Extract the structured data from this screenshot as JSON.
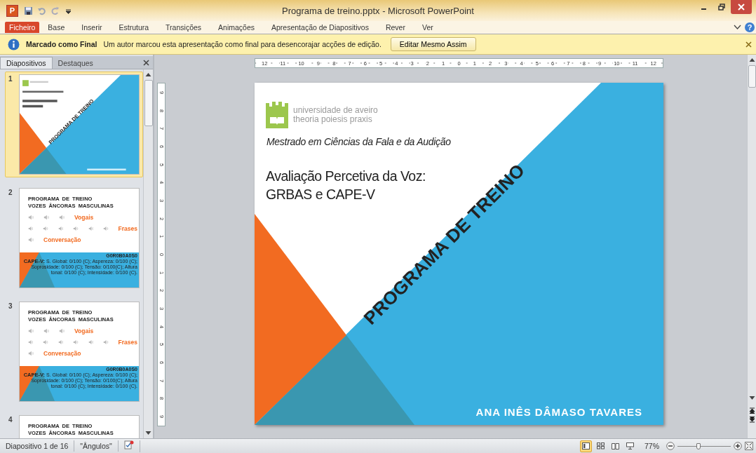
{
  "window": {
    "app_badge": "P",
    "title": "Programa de treino.pptx - Microsoft PowerPoint",
    "help": "?"
  },
  "ribbon_tabs": [
    {
      "label": "Ficheiro",
      "kind": "file"
    },
    {
      "label": "Base",
      "kind": "tab"
    },
    {
      "label": "Inserir",
      "kind": "tab"
    },
    {
      "label": "Estrutura",
      "kind": "tab"
    },
    {
      "label": "Transições",
      "kind": "tab"
    },
    {
      "label": "Animações",
      "kind": "tab"
    },
    {
      "label": "Apresentação de Diapositivos",
      "kind": "tab"
    },
    {
      "label": "Rever",
      "kind": "tab"
    },
    {
      "label": "Ver",
      "kind": "tab"
    }
  ],
  "message_bar": {
    "title": "Marcado como Final",
    "message": "Um autor marcou esta apresentação como final para desencorajar acções de edição.",
    "button": "Editar Mesmo Assim"
  },
  "panel_tabs": [
    {
      "label": "Diapositivos",
      "selected": true
    },
    {
      "label": "Destaques",
      "selected": false
    }
  ],
  "thumbnails": [
    {
      "number": "1",
      "selected": true,
      "kind": "title",
      "heading": "PROGRAMA DE TREINO"
    },
    {
      "number": "2",
      "selected": false,
      "kind": "audio",
      "lines": [
        "PROGRAMA  DE  TREINO",
        "VOZES  ÂNCORAS  MASCULINAS"
      ],
      "labels": [
        "Vogais",
        "Frases",
        "Conversação"
      ],
      "score": "G0R0B0A0S0",
      "cape": "**CAPE-V:** S. Global: 0/100 (C); Aspereza: 0/100 (C); Soprosidade: 0/100 (C); Tensão: 0/100(C); Altura tonal: 0/100 (C); Intensidade: 0/100 (C)."
    },
    {
      "number": "3",
      "selected": false,
      "kind": "audio",
      "lines": [
        "PROGRAMA  DE  TREINO",
        "VOZES  ÂNCORAS  MASCULINAS"
      ],
      "labels": [
        "Vogais",
        "Frases",
        "Conversação"
      ],
      "score": "G0R0B0A0S0",
      "cape": "**CAPE-V:** S. Global: 0/100 (C); Aspereza: 0/100 (C); Soprosidade: 0/100 (C); Tensão: 0/100(C); Altura tonal: 0/100 (C); Intensidade: 0/100 (C)."
    },
    {
      "number": "4",
      "selected": false,
      "kind": "audio",
      "lines": [
        "PROGRAMA  DE  TREINO",
        "VOZES  ÂNCORAS  MASCULINAS"
      ]
    }
  ],
  "ruler": {
    "horizontal": [
      "12",
      "11",
      "10",
      "9",
      "8",
      "7",
      "6",
      "5",
      "4",
      "3",
      "2",
      "1",
      "0",
      "1",
      "2",
      "3",
      "4",
      "5",
      "6",
      "7",
      "8",
      "9",
      "10",
      "11",
      "12"
    ],
    "vertical": [
      "9",
      "8",
      "7",
      "6",
      "5",
      "4",
      "3",
      "2",
      "1",
      "0",
      "1",
      "2",
      "3",
      "4",
      "5",
      "6",
      "7",
      "8",
      "9"
    ]
  },
  "slide": {
    "logo_name": "universidade de aveiro",
    "logo_motto": "theoria poiesis praxis",
    "program": "Mestrado em Ciências da Fala e da Audição",
    "title_lines": [
      "Avaliação Percetiva da Voz:",
      "GRBAS e CAPE-V"
    ],
    "banner": "PROGRAMA DE TREINO",
    "author": "ANA INÊS DÂMASO TAVARES"
  },
  "status_bar": {
    "slide_info": "Diapositivo 1 de 16",
    "theme": "\"Ângulos\"",
    "views": [
      {
        "kind": "normal",
        "selected": true
      },
      {
        "kind": "sorter",
        "selected": false
      },
      {
        "kind": "reading",
        "selected": false
      },
      {
        "kind": "slideshow",
        "selected": false
      }
    ],
    "zoom": "77%",
    "zoom_slider": {
      "level": 0.4
    }
  }
}
